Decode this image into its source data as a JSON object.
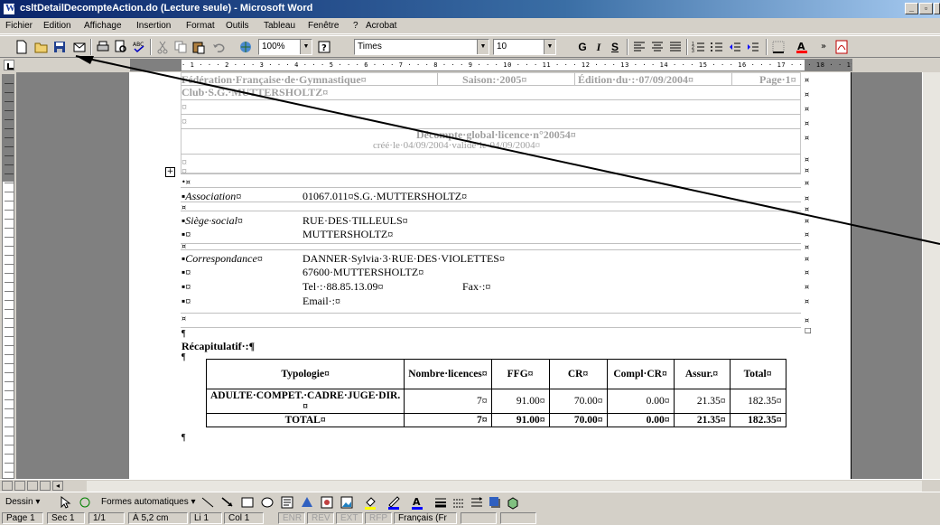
{
  "window": {
    "title": "csltDetailDecompteAction.do (Lecture seule) - Microsoft Word"
  },
  "menu": [
    "Fichier",
    "Edition",
    "Affichage",
    "Insertion",
    "Format",
    "Outils",
    "Tableau",
    "Fenêtre",
    "?",
    "Acrobat"
  ],
  "toolbar": {
    "zoom": "100%",
    "font": "Times",
    "size": "10",
    "bold": "G",
    "italic": "I",
    "underline": "S"
  },
  "ruler": {
    "ticks": "· 1 · · · 2 · · · 3 · · · 4 · · · 5 · · · 6 · · · 7 · · · 8 · · · 9 · · · 10 · · · 11 · · · 12 · · · 13 · · · 14 · · · 15 · · · 16 · · · 17 · · · 18 · · 19"
  },
  "document": {
    "header": {
      "federation": "Fédération·Française·de·Gymnastique¤",
      "saison": "Saison:·2005¤",
      "edition": "Édition·du·:·07/09/2004¤",
      "page": "Page·1¤",
      "club": "Club·S.G.·MUTTERSHOLTZ¤",
      "decompte_title": "Décompte·global·licence·n°20054¤",
      "decompte_sub": "créé·le·04/09/2004·validé·le·04/09/2004¤"
    },
    "fields": [
      {
        "label": "Association¤",
        "value": "01067.011¤S.G.·MUTTERSHOLTZ¤"
      },
      {
        "label": "Siège·social¤",
        "value": "RUE·DES·TILLEULS¤"
      },
      {
        "label": "¤",
        "value": "MUTTERSHOLTZ¤"
      },
      {
        "label": "Correspondance¤",
        "value": "DANNER·Sylvia·3·RUE·DES·VIOLETTES¤"
      },
      {
        "label": "¤",
        "value": "67600·MUTTERSHOLTZ¤"
      },
      {
        "label": "¤",
        "value": "Tel·:·88.85.13.09¤",
        "extra": "Fax·:¤"
      },
      {
        "label": "¤",
        "value": "Email·:¤"
      }
    ],
    "recap_title": "Récapitulatif·:¶",
    "table": {
      "headers": [
        "Typologie¤",
        "Nombre·licences¤",
        "FFG¤",
        "CR¤",
        "Compl·CR¤",
        "Assur.¤",
        "Total¤"
      ],
      "rows": [
        [
          "ADULTE·COMPET.·CADRE·JUGE·DIR.¤",
          "7¤",
          "91.00¤",
          "70.00¤",
          "0.00¤",
          "21.35¤",
          "182.35¤"
        ]
      ],
      "total": [
        "TOTAL¤",
        "7¤",
        "91.00¤",
        "70.00¤",
        "0.00¤",
        "21.35¤",
        "182.35¤"
      ]
    }
  },
  "drawbar": {
    "dessin": "Dessin ▾",
    "formes": "Formes automatiques ▾"
  },
  "status": {
    "page": "Page 1",
    "sec": "Sec 1",
    "pages": "1/1",
    "position": "À 5,2 cm",
    "line": "Li 1",
    "col": "Col 1",
    "enr": "ENR",
    "rev": "REV",
    "ext": "EXT",
    "rfp": "RFP",
    "lang": "Français (Fr"
  }
}
